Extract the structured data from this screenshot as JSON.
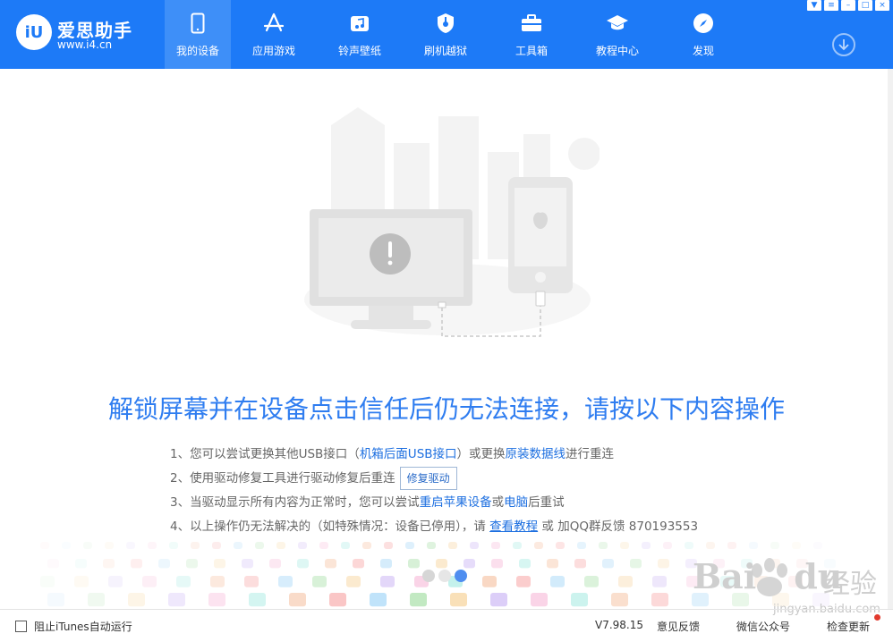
{
  "app": {
    "name": "爱思助手",
    "logo_mark": "iU",
    "url": "www.i4.cn"
  },
  "nav": [
    {
      "label": "我的设备",
      "icon": "phone-icon",
      "active": true
    },
    {
      "label": "应用游戏",
      "icon": "app-store-icon",
      "active": false
    },
    {
      "label": "铃声壁纸",
      "icon": "music-icon",
      "active": false
    },
    {
      "label": "刷机越狱",
      "icon": "shield-key-icon",
      "active": false
    },
    {
      "label": "工具箱",
      "icon": "toolbox-icon",
      "active": false
    },
    {
      "label": "教程中心",
      "icon": "graduation-cap-icon",
      "active": false
    },
    {
      "label": "发现",
      "icon": "compass-icon",
      "active": false
    }
  ],
  "window_controls": [
    "shirt-icon",
    "menu-icon",
    "minimize-icon",
    "maximize-icon",
    "close-icon"
  ],
  "main": {
    "headline": "解锁屏幕并在设备点击信任后仍无法连接，请按以下内容操作",
    "steps": {
      "s1_pre": "1、您可以尝试更换其他USB接口（",
      "s1_link1": "机箱后面USB接口",
      "s1_mid": "）或更换",
      "s1_link2": "原装数据线",
      "s1_post": "进行重连",
      "s2_text": "2、使用驱动修复工具进行驱动修复后重连",
      "s2_button": "修复驱动",
      "s3_pre": "3、当驱动显示所有内容为正常时，您可以尝试",
      "s3_link1": "重启苹果设备",
      "s3_mid": "或",
      "s3_link2": "电脑",
      "s3_post": "后重试",
      "s4_pre": "4、以上操作仍无法解决的（如特殊情况：设备已停用），请 ",
      "s4_link": "查看教程",
      "s4_post": " 或 加QQ群反馈 870193553"
    },
    "carousel": {
      "count": 3,
      "active_index": 2
    }
  },
  "statusbar": {
    "itunes_checkbox_label": "阻止iTunes自动运行",
    "itunes_checked": false,
    "version": "V7.98.15",
    "feedback": "意见反馈",
    "wechat": "微信公众号",
    "check_update": "检查更新"
  },
  "watermark": {
    "text": "Bai",
    "text2": "du",
    "cn": "经验",
    "url": "jingyan.baidu.com"
  },
  "colors": {
    "brand_blue": "#1d7af7",
    "link_blue": "#1d6fe0",
    "headline_blue": "#2f7df0",
    "notification_red": "#e23a2e"
  }
}
